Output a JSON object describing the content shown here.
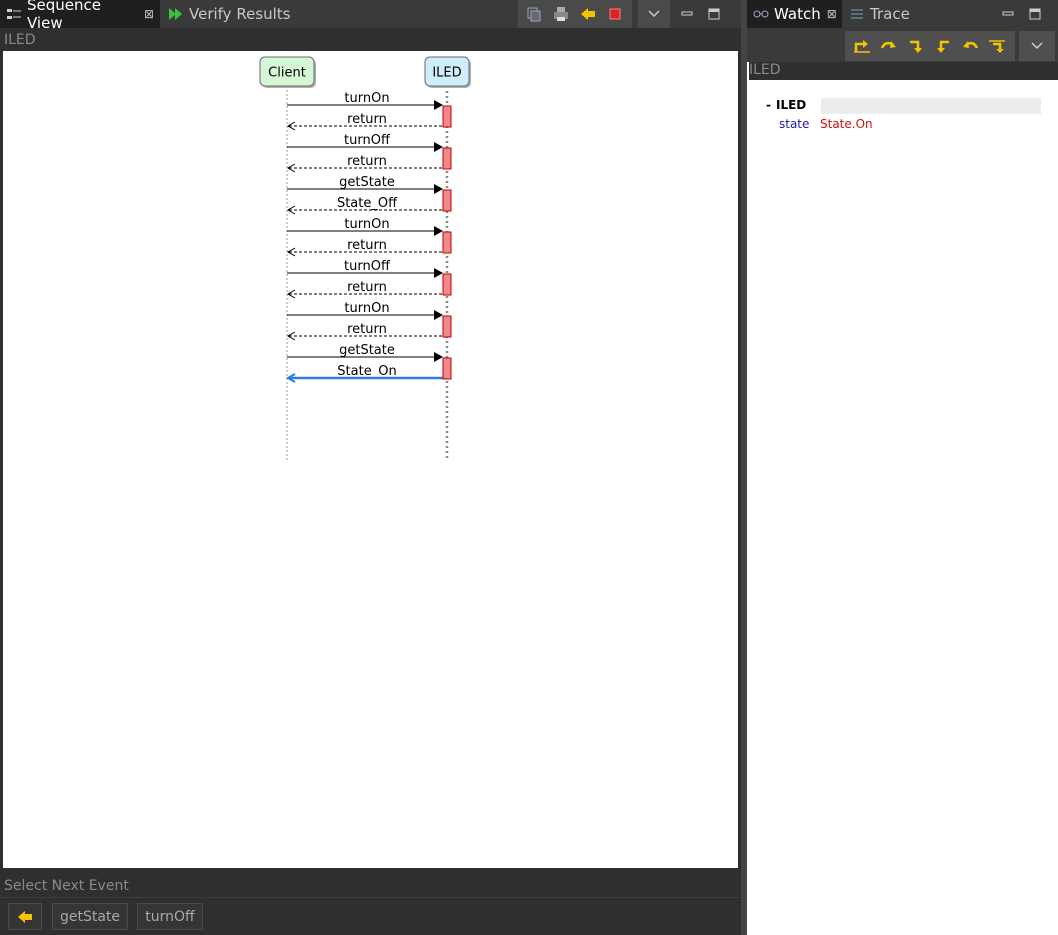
{
  "left_tabs": [
    {
      "label": "Sequence View",
      "icon": "sequence-view-icon",
      "active": true
    },
    {
      "label": "Verify Results",
      "icon": "verify-results-icon",
      "active": false
    }
  ],
  "left_crumb": "ILED",
  "diagram": {
    "lifelines": [
      {
        "name": "Client",
        "color": "#d6f7d6"
      },
      {
        "name": "ILED",
        "color": "#cdeefa"
      }
    ],
    "messages": [
      {
        "label": "turnOn",
        "kind": "call"
      },
      {
        "label": "return",
        "kind": "return"
      },
      {
        "label": "turnOff",
        "kind": "call"
      },
      {
        "label": "return",
        "kind": "return"
      },
      {
        "label": "getState",
        "kind": "call"
      },
      {
        "label": "State_Off",
        "kind": "return"
      },
      {
        "label": "turnOn",
        "kind": "call"
      },
      {
        "label": "return",
        "kind": "return"
      },
      {
        "label": "turnOff",
        "kind": "call"
      },
      {
        "label": "return",
        "kind": "return"
      },
      {
        "label": "turnOn",
        "kind": "call"
      },
      {
        "label": "return",
        "kind": "return"
      },
      {
        "label": "getState",
        "kind": "call"
      },
      {
        "label": "State_On",
        "kind": "selected-return"
      }
    ],
    "activation_color": "#f08a8a",
    "selected_color": "#2a7de1"
  },
  "select_next_event": {
    "label": "Select Next Event",
    "events": [
      "getState",
      "turnOff"
    ]
  },
  "right_tabs": [
    {
      "label": "Watch",
      "icon": "watch-icon",
      "active": true
    },
    {
      "label": "Trace",
      "icon": "trace-icon",
      "active": false
    }
  ],
  "right_crumb": "ILED",
  "watch": {
    "root": {
      "toggle": "-",
      "name": "ILED"
    },
    "fields": [
      {
        "name": "state",
        "value": "State.On"
      }
    ]
  }
}
